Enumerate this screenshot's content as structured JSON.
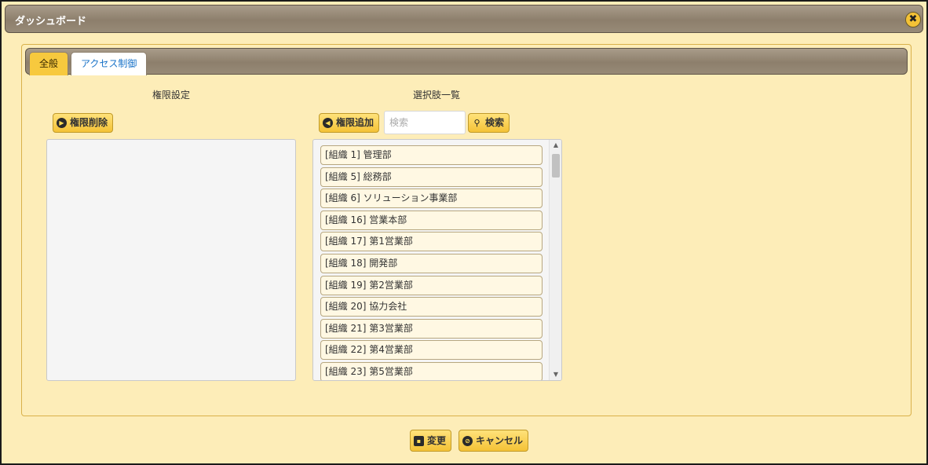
{
  "window": {
    "title": "ダッシュボード",
    "close_icon": "✖"
  },
  "tabs": [
    {
      "label": "全般",
      "active": false
    },
    {
      "label": "アクセス制御",
      "active": true
    }
  ],
  "permission_panel": {
    "title": "権限設定",
    "remove_button": {
      "label": "権限削除",
      "icon": "circle-arrow-right-icon"
    }
  },
  "choices_panel": {
    "title": "選択肢一覧",
    "add_button": {
      "label": "権限追加",
      "icon": "circle-arrow-left-icon"
    },
    "search": {
      "placeholder": "検索",
      "value": ""
    },
    "search_button": {
      "label": "検索",
      "icon": "search-icon"
    },
    "items": [
      "[組織 1] 管理部",
      "[組織 5] 総務部",
      "[組織 6] ソリューション事業部",
      "[組織 16] 営業本部",
      "[組織 17] 第1営業部",
      "[組織 18] 開発部",
      "[組織 19] 第2営業部",
      "[組織 20] 協力会社",
      "[組織 21] 第3営業部",
      "[組織 22] 第4営業部",
      "[組織 23] 第5営業部"
    ]
  },
  "footer": {
    "save_button": {
      "label": "変更",
      "icon": "save-icon"
    },
    "cancel_button": {
      "label": "キャンセル",
      "icon": "cancel-icon"
    }
  },
  "colors": {
    "background": "#fdedb8",
    "button": "#f4c236",
    "header": "#978a77",
    "active_tab_text": "#1a73c8"
  }
}
